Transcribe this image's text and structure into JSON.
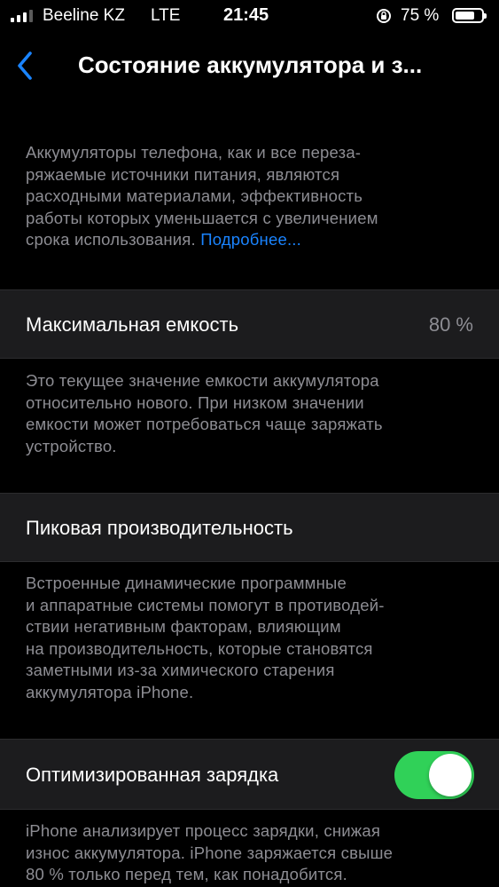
{
  "status_bar": {
    "carrier": "Beeline KZ",
    "network": "LTE",
    "time": "21:45",
    "battery_percent": "75 %",
    "battery_level": 0.75,
    "icons": [
      "signal-icon",
      "rotation-lock-icon",
      "battery-icon"
    ]
  },
  "nav": {
    "back_icon": "chevron-left-icon",
    "title": "Состояние аккумулятора и з..."
  },
  "intro": {
    "text": "Аккумуляторы телефона, как и все переза-\nряжаемые источники питания, являются\nрасходными материалами, эффективность\nработы которых уменьшается с увеличением\nсрока использования. ",
    "link": "Подробнее..."
  },
  "max_capacity": {
    "label": "Максимальная емкость",
    "value": "80 %",
    "description": "Это текущее значение емкости аккумулятора\nотносительно нового. При низком значении\nемкости может потребоваться чаще заряжать\nустройство."
  },
  "peak_performance": {
    "label": "Пиковая производительность",
    "description": "Встроенные динамические программные\nи аппаратные системы помогут в противодей-\nствии негативным факторам, влияющим\nна производительность, которые становятся\nзаметными из-за химического старения\nаккумулятора iPhone."
  },
  "optimized_charging": {
    "label": "Оптимизированная зарядка",
    "enabled": true,
    "toggle_color": "#30d158",
    "description": "iPhone анализирует процесс зарядки, снижая\nизнос аккумулятора. iPhone заряжается свыше\n80 % только перед тем, как понадобится."
  },
  "colors": {
    "background": "#000000",
    "cell": "#1c1c1e",
    "secondary_text": "#8d8d93",
    "link": "#1a84ff"
  }
}
